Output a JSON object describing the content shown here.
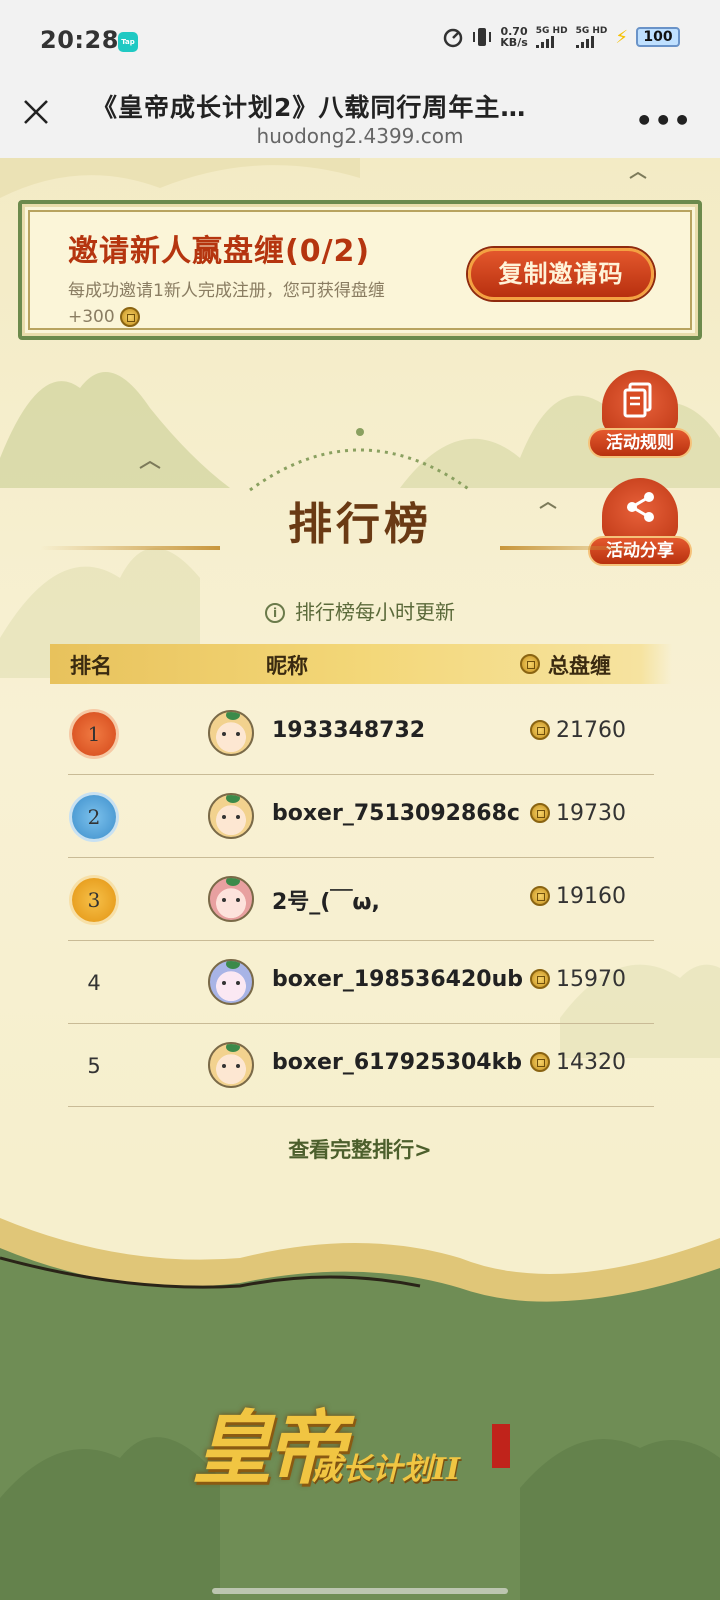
{
  "status_bar": {
    "time": "20:28",
    "app_badge": "Tap",
    "speed_value": "0.70",
    "speed_unit": "KB/s",
    "sim1": "5G HD",
    "sim2": "5G HD",
    "battery": "100"
  },
  "browser": {
    "title": "《皇帝成长计划2》八载同行周年主…",
    "url": "huodong2.4399.com",
    "more_label": "•••"
  },
  "invite": {
    "title": "邀请新人赢盘缠(0/2)",
    "desc_line1": "每成功邀请1新人完成注册，您可获得盘缠",
    "desc_line2": "+300",
    "copy_button": "复制邀请码"
  },
  "side_buttons": {
    "rules": "活动规则",
    "share": "活动分享"
  },
  "ranking": {
    "title": "排行榜",
    "update_note": "排行榜每小时更新",
    "columns": {
      "rank": "排名",
      "nickname": "昵称",
      "total": "总盘缠"
    },
    "rows": [
      {
        "rank": "1",
        "nickname": "1933348732",
        "score": "21760"
      },
      {
        "rank": "2",
        "nickname": "boxer_7513092868c",
        "score": "19730"
      },
      {
        "rank": "3",
        "nickname": "2号_(￣ω,",
        "score": "19160"
      },
      {
        "rank": "4",
        "nickname": "boxer_198536420ub",
        "score": "15970"
      },
      {
        "rank": "5",
        "nickname": "boxer_617925304kb",
        "score": "14320"
      }
    ],
    "view_all": "查看完整排行>"
  },
  "logo": {
    "main": "皇帝",
    "sub": "成长计划II"
  },
  "colors": {
    "accent_red": "#b5350f",
    "frame_green": "#6c8a4c",
    "footer_green": "#6f8d55"
  }
}
